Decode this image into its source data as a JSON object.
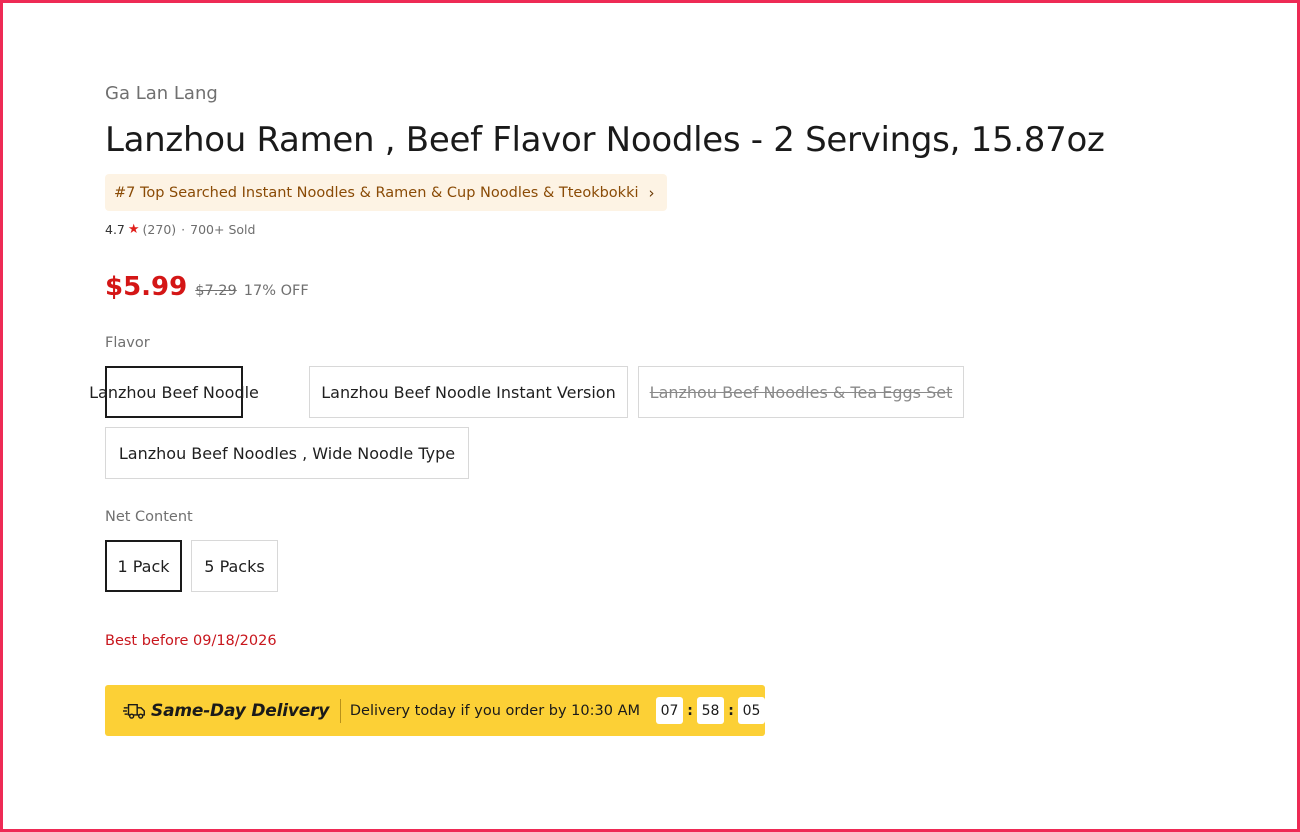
{
  "product": {
    "brand": "Ga Lan Lang",
    "title": "Lanzhou Ramen , Beef Flavor Noodles - 2 Servings, 15.87oz",
    "rank_badge": "#7 Top Searched Instant Noodles & Ramen & Cup Noodles & Tteokbokki",
    "rating": "4.7",
    "reviews": "(270)",
    "separator": "·",
    "sold": "700+ Sold",
    "price": "$5.99",
    "original_price": "$7.29",
    "discount": "17% OFF",
    "best_before": "Best before 09/18/2026"
  },
  "flavor": {
    "label": "Flavor",
    "options": [
      {
        "label": "Lanzhou Beef Noodle",
        "state": "selected"
      },
      {
        "label": "Lanzhou Beef Noodle Instant Version",
        "state": "available"
      },
      {
        "label": "Lanzhou Beef Noodles & Tea Eggs Set",
        "state": "unavailable"
      },
      {
        "label": "Lanzhou Beef Noodles , Wide Noodle Type",
        "state": "available"
      }
    ]
  },
  "net_content": {
    "label": "Net Content",
    "options": [
      {
        "label": "1 Pack",
        "state": "selected"
      },
      {
        "label": "5 Packs",
        "state": "available"
      }
    ]
  },
  "delivery": {
    "title": "Same-Day Delivery",
    "message": "Delivery today if you order by 10:30 AM",
    "countdown": {
      "hours": "07",
      "minutes": "58",
      "seconds": "05",
      "sep": ":"
    }
  },
  "icons": {
    "star": "star-icon",
    "chevron": "chevron-right-icon",
    "truck": "delivery-truck-icon"
  },
  "colors": {
    "price": "#d41616",
    "badge_bg": "#fdf3e4",
    "badge_text": "#8a4b06",
    "delivery_bg": "#fcd036",
    "frame": "#ee2a55"
  }
}
